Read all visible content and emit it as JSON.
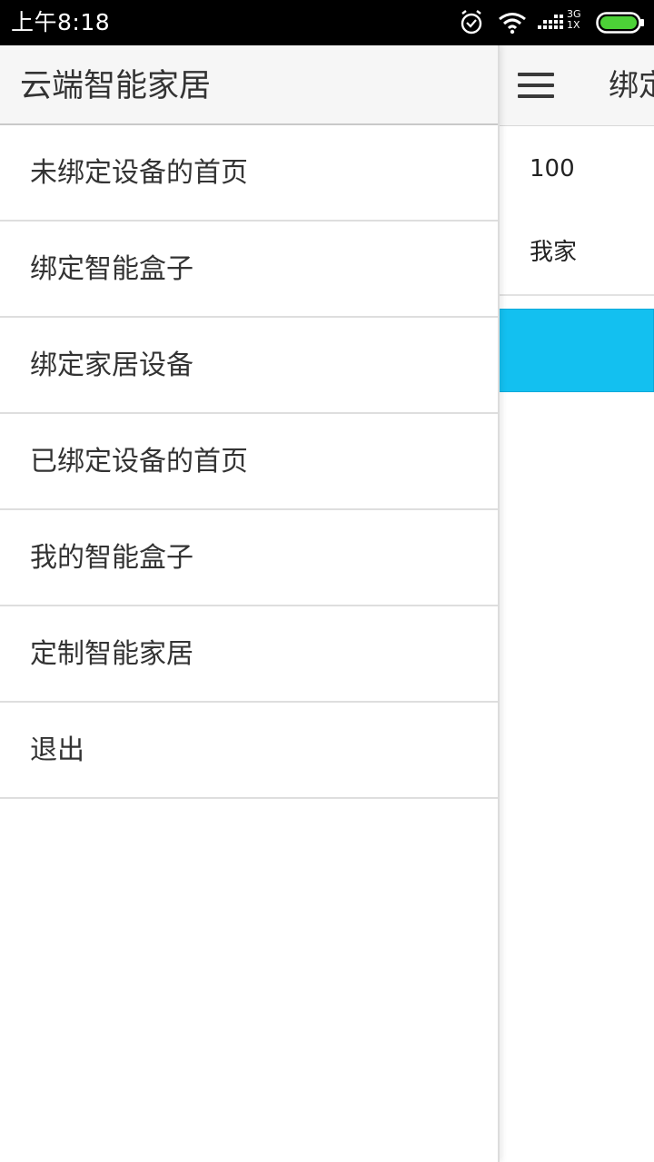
{
  "status_bar": {
    "time": "上午8:18",
    "network_top": "3G",
    "network_bottom": "1X",
    "icons": [
      "alarm-icon",
      "wifi-icon",
      "signal-icon",
      "battery-icon"
    ],
    "battery_color": "#4cd137"
  },
  "drawer": {
    "title": "云端智能家居",
    "items": [
      {
        "label": "未绑定设备的首页"
      },
      {
        "label": "绑定智能盒子"
      },
      {
        "label": "绑定家居设备"
      },
      {
        "label": "已绑定设备的首页"
      },
      {
        "label": "我的智能盒子"
      },
      {
        "label": "定制智能家居"
      },
      {
        "label": "退出"
      }
    ]
  },
  "main": {
    "title": "绑定",
    "menu_icon": "hamburger-menu-icon",
    "field_1_value": "100",
    "field_2_value": "我家",
    "button_color": "#13c0f0"
  }
}
